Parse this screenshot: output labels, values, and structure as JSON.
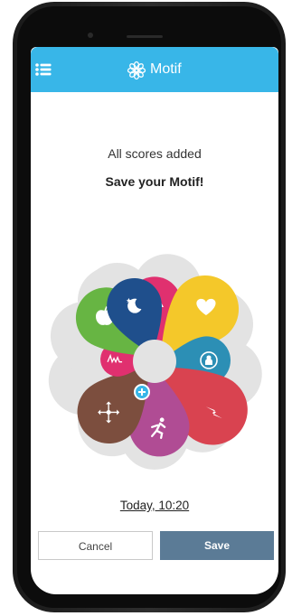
{
  "app": {
    "title": "Motif",
    "menu_icon": "hamburger-menu-icon",
    "logo_icon": "flower-logo-icon",
    "header_color": "#38b6e8"
  },
  "main": {
    "status_text": "All scores added",
    "prompt_text": "Save your Motif!",
    "date_link": "Today, 10:20"
  },
  "wheel": {
    "center_icon": "plus-circle-icon",
    "petals": [
      {
        "icon": "warning-triangle-icon",
        "color": "#e0306f"
      },
      {
        "icon": "heart-icon",
        "color": "#f4c82a"
      },
      {
        "icon": "person-circle-icon",
        "color": "#2c8fb5"
      },
      {
        "icon": "lightning-icon",
        "color": "#d94350"
      },
      {
        "icon": "running-person-icon",
        "color": "#b04c94"
      },
      {
        "icon": "move-arrows-icon",
        "color": "#7c4e3e"
      },
      {
        "icon": "activity-wave-icon",
        "color": "#e0306f"
      },
      {
        "icon": "apple-icon",
        "color": "#67b543"
      },
      {
        "icon": "moon-stars-icon",
        "color": "#1f4f8c"
      }
    ]
  },
  "actions": {
    "cancel_label": "Cancel",
    "save_label": "Save",
    "save_color": "#5b7b96"
  }
}
